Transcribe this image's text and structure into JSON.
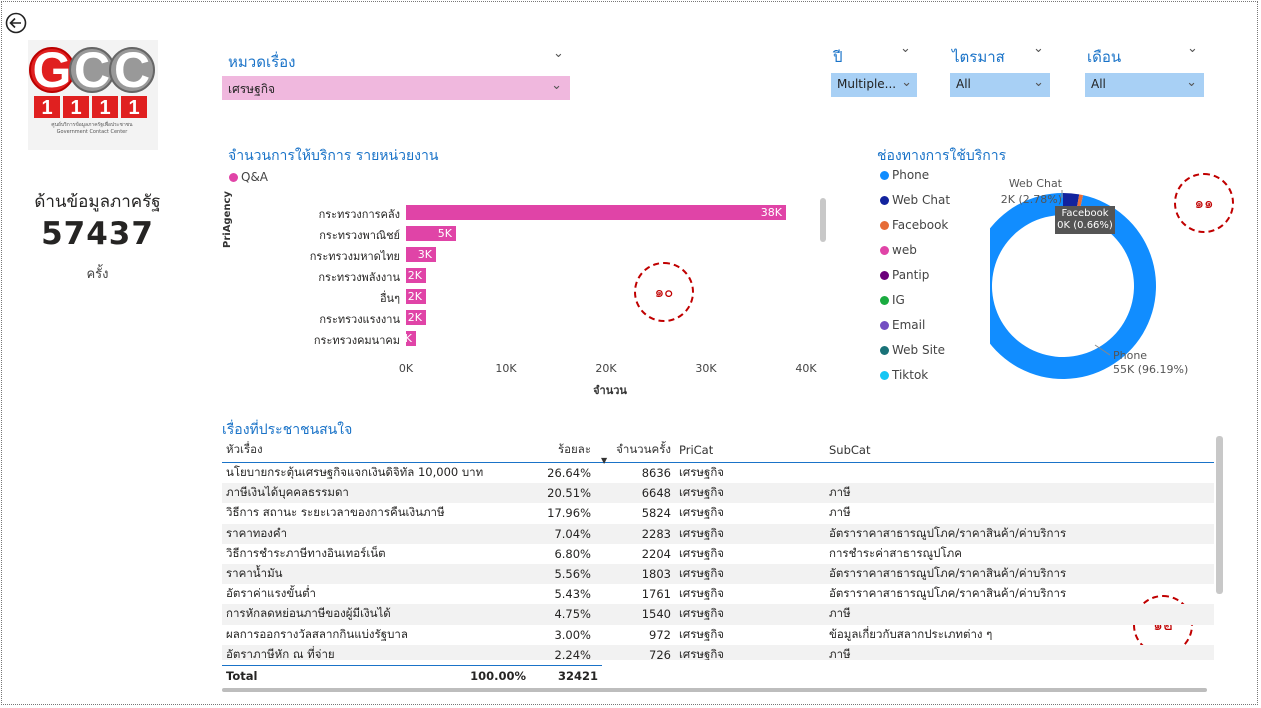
{
  "nav": {
    "back_icon": "back-arrow-icon"
  },
  "logo": {
    "letters": "GCC",
    "number": "1111",
    "caption_th": "ศูนย์บริการข้อมูลภาครัฐเพื่อประชาชน",
    "caption_en": "Government Contact Center"
  },
  "kpi": {
    "label": "ด้านข้อมูลภาครัฐ",
    "value": "57437",
    "unit": "ครั้ง"
  },
  "slicers": {
    "topic": {
      "title": "หมวดเรื่อง",
      "value": "เศรษฐกิจ"
    },
    "year": {
      "title": "ปี",
      "value": "Multiple..."
    },
    "quarter": {
      "title": "ไตรมาส",
      "value": "All"
    },
    "month": {
      "title": "เดือน",
      "value": "All"
    }
  },
  "bar_chart": {
    "title": "จำนวนการให้บริการ รายหน่วยงาน",
    "legend": "Q&A",
    "ylabel": "PriAgency",
    "xlabel": "จำนวน",
    "color": "#e044a7"
  },
  "donut_chart": {
    "title": "ช่องทางการใช้บริการ",
    "legend": [
      {
        "name": "Phone",
        "color": "#118dff"
      },
      {
        "name": "Web Chat",
        "color": "#12239e"
      },
      {
        "name": "Facebook",
        "color": "#e66c37"
      },
      {
        "name": "web",
        "color": "#e044a7"
      },
      {
        "name": "Pantip",
        "color": "#6b007b"
      },
      {
        "name": "IG",
        "color": "#1aab40"
      },
      {
        "name": "Email",
        "color": "#744ec2"
      },
      {
        "name": "Web Site",
        "color": "#197278"
      },
      {
        "name": "Tiktok",
        "color": "#15c6f4"
      }
    ],
    "labels": {
      "webchat_name": "Web Chat",
      "webchat_val": "2K (2.78%)",
      "facebook_name": "Facebook",
      "facebook_val": "0K (0.66%)",
      "phone_name": "Phone",
      "phone_val": "55K (96.19%)"
    }
  },
  "chart_data": [
    {
      "type": "bar",
      "orientation": "horizontal",
      "title": "จำนวนการให้บริการ รายหน่วยงาน",
      "xlabel": "จำนวน",
      "ylabel": "PriAgency",
      "categories": [
        "กระทรวงการคลัง",
        "กระทรวงพาณิชย์",
        "กระทรวงมหาดไทย",
        "กระทรวงพลังงาน",
        "อื่นๆ",
        "กระทรวงแรงงาน",
        "กระทรวงคมนาคม"
      ],
      "series": [
        {
          "name": "Q&A",
          "values": [
            38000,
            5000,
            3000,
            2000,
            2000,
            2000,
            1000
          ]
        }
      ],
      "data_labels": [
        "38K",
        "5K",
        "3K",
        "2K",
        "2K",
        "2K",
        "1K"
      ],
      "xticks": [
        "0K",
        "10K",
        "20K",
        "30K",
        "40K"
      ],
      "xlim": [
        0,
        40000
      ]
    },
    {
      "type": "pie",
      "variant": "donut",
      "title": "ช่องทางการใช้บริการ",
      "slices": [
        {
          "name": "Phone",
          "value": 96.19
        },
        {
          "name": "Web Chat",
          "value": 2.78
        },
        {
          "name": "Facebook",
          "value": 0.66
        }
      ]
    }
  ],
  "annotations": {
    "a10": "๑๐",
    "a11": "๑๑",
    "a12": "๑๒"
  },
  "table": {
    "title": "เรื่องที่ประชาชนสนใจ",
    "columns": [
      "หัวเรื่อง",
      "ร้อยละ",
      "จำนวนครั้ง",
      "PriCat",
      "SubCat"
    ],
    "rows": [
      [
        "นโยบายกระตุ้นเศรษฐกิจแจกเงินดิจิทัล 10,000 บาท",
        "26.64%",
        "8636",
        "เศรษฐกิจ",
        ""
      ],
      [
        "ภาษีเงินได้บุคคลธรรมดา",
        "20.51%",
        "6648",
        "เศรษฐกิจ",
        "ภาษี"
      ],
      [
        "วิธีการ สถานะ ระยะเวลาของการคืนเงินภาษี",
        "17.96%",
        "5824",
        "เศรษฐกิจ",
        "ภาษี"
      ],
      [
        "ราคาทองคำ",
        "7.04%",
        "2283",
        "เศรษฐกิจ",
        "อัตราราคาสาธารณูปโภค/ราคาสินค้า/ค่าบริการ"
      ],
      [
        "วิธีการชำระภาษีทางอินเทอร์เน็ต",
        "6.80%",
        "2204",
        "เศรษฐกิจ",
        "การชำระค่าสาธารณูปโภค"
      ],
      [
        "ราคาน้ำมัน",
        "5.56%",
        "1803",
        "เศรษฐกิจ",
        "อัตราราคาสาธารณูปโภค/ราคาสินค้า/ค่าบริการ"
      ],
      [
        "อัตราค่าแรงขั้นต่ำ",
        "5.43%",
        "1761",
        "เศรษฐกิจ",
        "อัตราราคาสาธารณูปโภค/ราคาสินค้า/ค่าบริการ"
      ],
      [
        "การหักลดหย่อนภาษีของผู้มีเงินได้",
        "4.75%",
        "1540",
        "เศรษฐกิจ",
        "ภาษี"
      ],
      [
        "ผลการออกรางวัลสลากกินแบ่งรัฐบาล",
        "3.00%",
        "972",
        "เศรษฐกิจ",
        "ข้อมูลเกี่ยวกับสลากประเภทต่าง ๆ"
      ],
      [
        "อัตราภาษีหัก ณ ที่จ่าย",
        "2.24%",
        "726",
        "เศรษฐกิจ",
        "ภาษี"
      ]
    ],
    "total": {
      "label": "Total",
      "pct": "100.00%",
      "count": "32421"
    }
  }
}
